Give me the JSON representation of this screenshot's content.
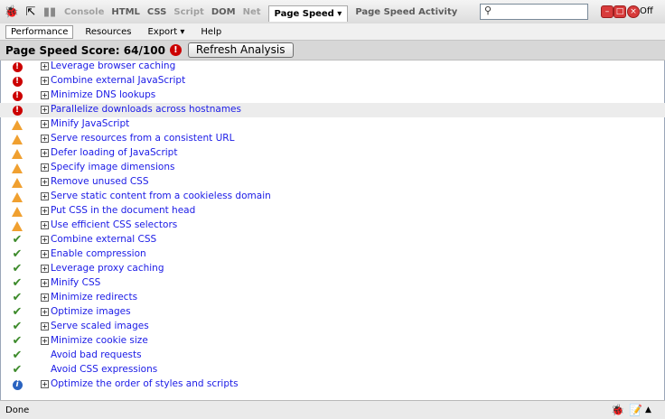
{
  "toolbar": {
    "tabs": [
      {
        "label": "Console",
        "state": "dim"
      },
      {
        "label": "HTML",
        "state": "normal"
      },
      {
        "label": "CSS",
        "state": "normal"
      },
      {
        "label": "Script",
        "state": "dim"
      },
      {
        "label": "DOM",
        "state": "normal"
      },
      {
        "label": "Net",
        "state": "dim"
      },
      {
        "label": "Page Speed ▾",
        "state": "active"
      },
      {
        "label": "Page Speed Activity",
        "state": "normal"
      }
    ],
    "search_placeholder": "",
    "off_label": "Off"
  },
  "subbar": {
    "items": [
      "Performance",
      "Resources",
      "Export ▾",
      "Help"
    ]
  },
  "score": {
    "label": "Page Speed Score: 64/100",
    "refresh_label": "Refresh Analysis"
  },
  "rules": [
    {
      "label": "Leverage browser caching",
      "status": "error",
      "expandable": true
    },
    {
      "label": "Combine external JavaScript",
      "status": "error",
      "expandable": true
    },
    {
      "label": "Minimize DNS lookups",
      "status": "error",
      "expandable": true
    },
    {
      "label": "Parallelize downloads across hostnames",
      "status": "error",
      "expandable": true,
      "highlight": true
    },
    {
      "label": "Minify JavaScript",
      "status": "warning",
      "expandable": true
    },
    {
      "label": "Serve resources from a consistent URL",
      "status": "warning",
      "expandable": true
    },
    {
      "label": "Defer loading of JavaScript",
      "status": "warning",
      "expandable": true
    },
    {
      "label": "Specify image dimensions",
      "status": "warning",
      "expandable": true
    },
    {
      "label": "Remove unused CSS",
      "status": "warning",
      "expandable": true
    },
    {
      "label": "Serve static content from a cookieless domain",
      "status": "warning",
      "expandable": true
    },
    {
      "label": "Put CSS in the document head",
      "status": "warning",
      "expandable": true
    },
    {
      "label": "Use efficient CSS selectors",
      "status": "warning",
      "expandable": true
    },
    {
      "label": "Combine external CSS",
      "status": "ok",
      "expandable": true
    },
    {
      "label": "Enable compression",
      "status": "ok",
      "expandable": true
    },
    {
      "label": "Leverage proxy caching",
      "status": "ok",
      "expandable": true
    },
    {
      "label": "Minify CSS",
      "status": "ok",
      "expandable": true
    },
    {
      "label": "Minimize redirects",
      "status": "ok",
      "expandable": true
    },
    {
      "label": "Optimize images",
      "status": "ok",
      "expandable": true
    },
    {
      "label": "Serve scaled images",
      "status": "ok",
      "expandable": true
    },
    {
      "label": "Minimize cookie size",
      "status": "ok",
      "expandable": true
    },
    {
      "label": "Avoid bad requests",
      "status": "ok",
      "expandable": false
    },
    {
      "label": "Avoid CSS expressions",
      "status": "ok",
      "expandable": false
    },
    {
      "label": "Optimize the order of styles and scripts",
      "status": "info",
      "expandable": true
    }
  ],
  "statusbar": {
    "text": "Done"
  },
  "colors": {
    "link": "#1a1ae6",
    "error": "#cc0000",
    "warning": "#f0a030",
    "ok": "#3c8a2a",
    "info": "#2a63c0"
  }
}
